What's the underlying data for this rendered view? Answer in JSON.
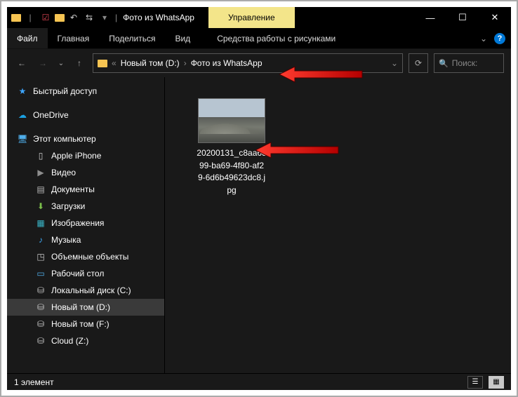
{
  "titlebar": {
    "title_sep": "|",
    "title": "Фото из WhatsApp",
    "contextual": "Управление",
    "min": "—",
    "max": "☐",
    "close": "✕"
  },
  "ribbon": {
    "file": "Файл",
    "tabs": [
      "Главная",
      "Поделиться",
      "Вид"
    ],
    "contextual_tab": "Средства работы с рисунками",
    "expand": "⌄",
    "help": "?"
  },
  "nav": {
    "back": "←",
    "fwd": "→",
    "recent": "⌄",
    "up": "↑",
    "crumb_icon": "▧",
    "crumbs": [
      "«",
      "Новый том (D:)",
      "›",
      "Фото из WhatsApp"
    ],
    "crumb_drop": "⌄",
    "refresh": "⟳",
    "search_icon": "🔍",
    "search_placeholder": "Поиск:"
  },
  "sidebar": {
    "quick": "Быстрый доступ",
    "onedrive": "OneDrive",
    "pc": "Этот компьютер",
    "items": [
      {
        "icon": "▯",
        "cls": "phone",
        "label": "Apple iPhone"
      },
      {
        "icon": "▶",
        "cls": "video",
        "label": "Видео"
      },
      {
        "icon": "▤",
        "cls": "docs",
        "label": "Документы"
      },
      {
        "icon": "⬇",
        "cls": "dl",
        "label": "Загрузки"
      },
      {
        "icon": "▦",
        "cls": "img",
        "label": "Изображения"
      },
      {
        "icon": "♪",
        "cls": "music",
        "label": "Музыка"
      },
      {
        "icon": "◳",
        "cls": "vol",
        "label": "Объемные объекты"
      },
      {
        "icon": "▭",
        "cls": "desk",
        "label": "Рабочий стол"
      },
      {
        "icon": "⛁",
        "cls": "disk",
        "label": "Локальный диск (C:)"
      },
      {
        "icon": "⛁",
        "cls": "disk",
        "label": "Новый том (D:)",
        "sel": true
      },
      {
        "icon": "⛁",
        "cls": "disk",
        "label": "Новый том (F:)"
      },
      {
        "icon": "⛁",
        "cls": "disk",
        "label": "Cloud (Z:)"
      }
    ]
  },
  "content": {
    "file_lines": [
      "20200131_c8aa68",
      "99-ba69-4f80-af2",
      "9-6d6b49623dc8.j",
      "pg"
    ]
  },
  "status": {
    "count": "1 элемент"
  }
}
